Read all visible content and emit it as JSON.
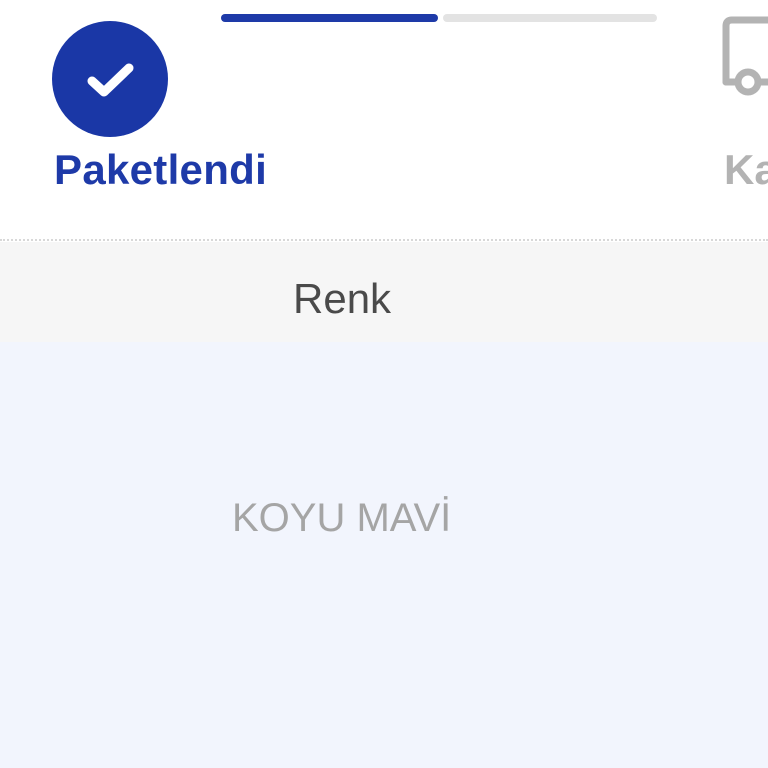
{
  "tracker": {
    "steps": [
      {
        "label": "Paketlendi",
        "status": "completed",
        "icon": "check-icon"
      },
      {
        "label": "Ka",
        "status": "pending",
        "icon": "truck-icon"
      }
    ],
    "progress": 0.5,
    "colors": {
      "active": "#1e3aa8",
      "pending": "#b3b3b3",
      "track": "#e3e3e3"
    }
  },
  "details": {
    "header": "Renk",
    "value": "KOYU MAVİ",
    "colors": {
      "header_bg": "#f6f6f6",
      "body_bg": "#f2f5fd"
    }
  }
}
